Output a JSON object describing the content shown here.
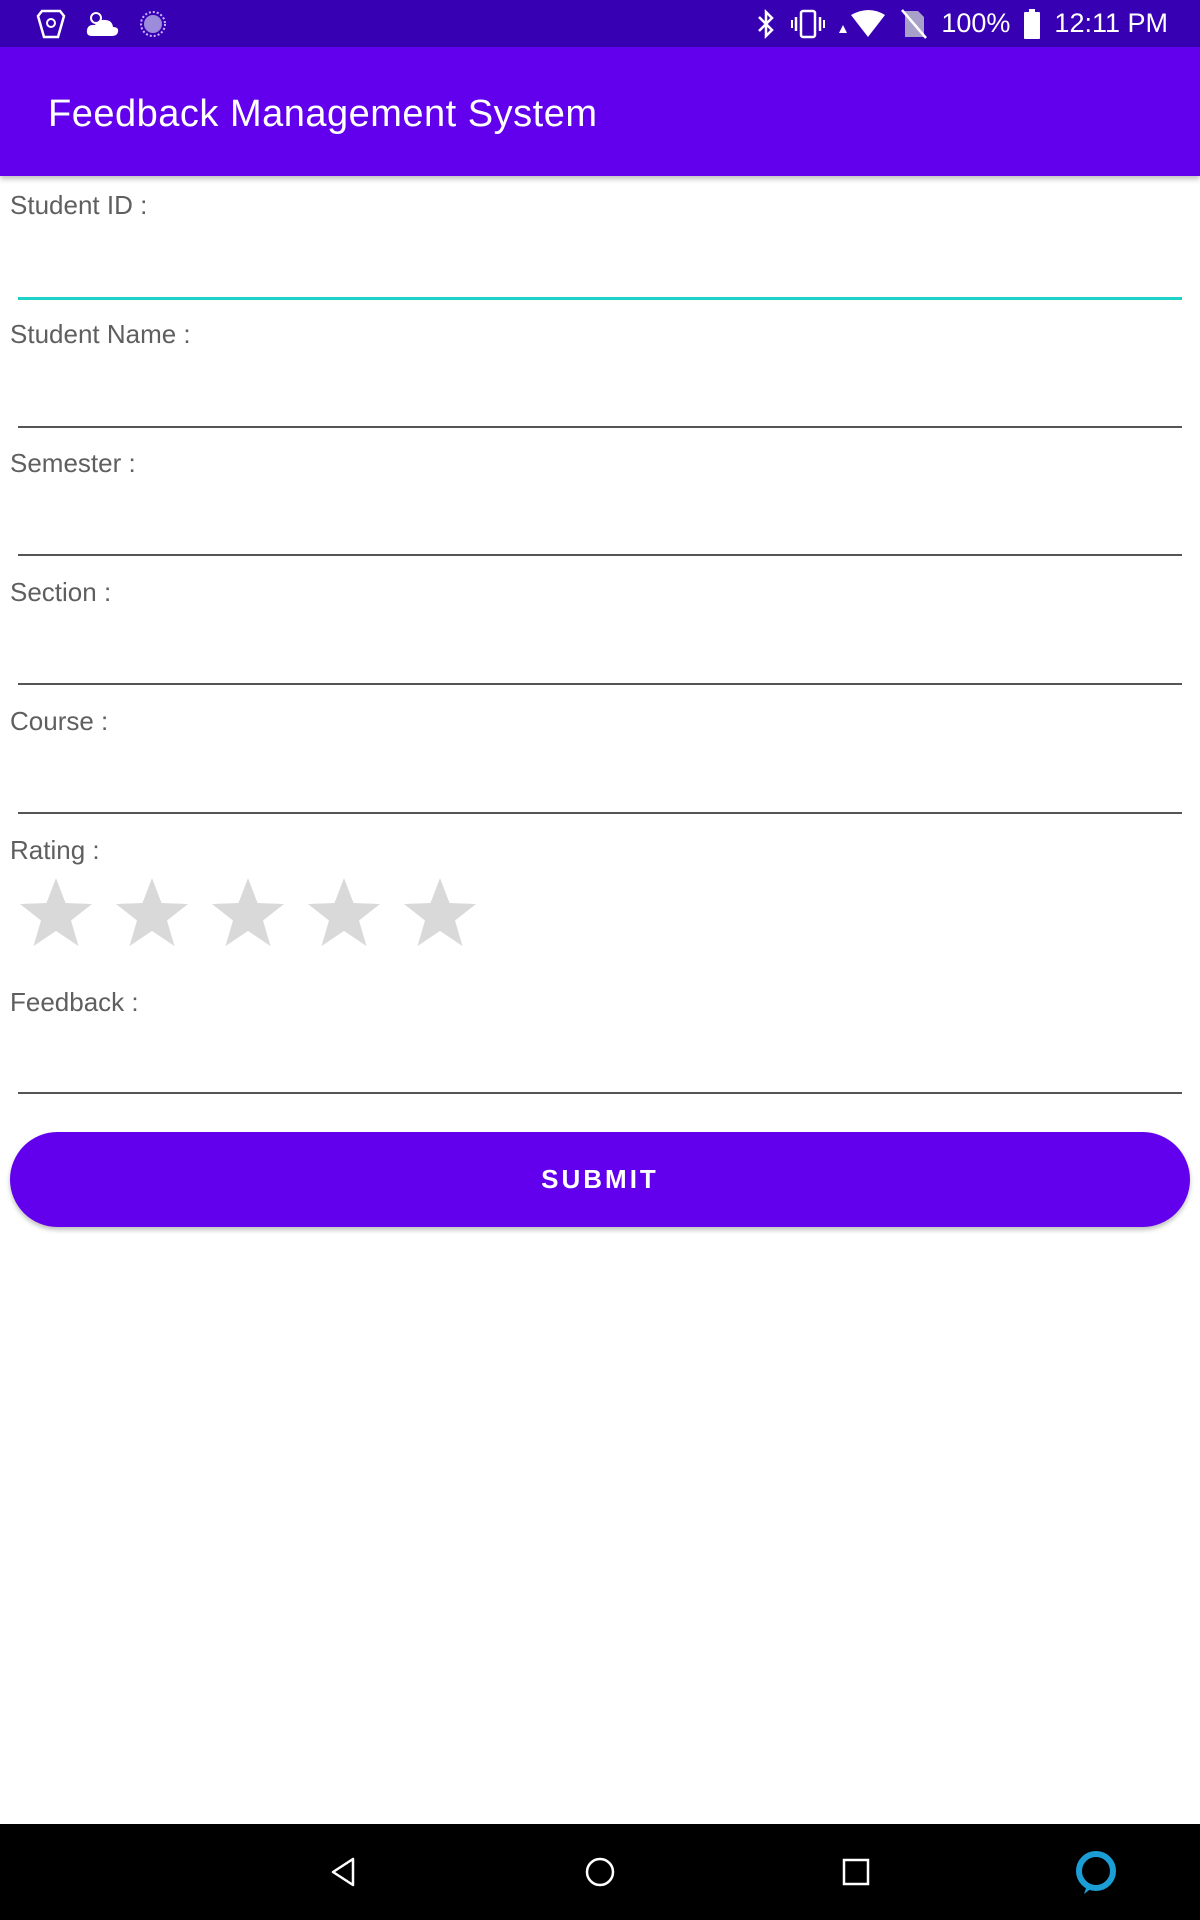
{
  "status_bar": {
    "battery": "100%",
    "time": "12:11 PM",
    "left_icons": [
      "shield-notification-icon",
      "weather-icon",
      "sync-icon"
    ],
    "right_icons": [
      "bluetooth-icon",
      "vibrate-icon",
      "wifi-icon",
      "no-sim-icon",
      "battery-icon"
    ]
  },
  "app_bar": {
    "title": "Feedback Management System"
  },
  "form": {
    "student_id_label": "Student ID :",
    "student_id_value": "",
    "student_name_label": "Student Name :",
    "student_name_value": "",
    "semester_label": "Semester :",
    "semester_value": "",
    "section_label": "Section :",
    "section_value": "",
    "course_label": "Course :",
    "course_value": "",
    "rating_label": "Rating :",
    "rating_value": 0,
    "rating_max": 5,
    "feedback_label": "Feedback :",
    "feedback_value": "",
    "submit_label": "SUBMIT"
  },
  "colors": {
    "status_bar": "#3700b3",
    "primary": "#6200ee",
    "focus_underline": "#1bd1c8",
    "star_empty": "#d9d9d9",
    "nav_bar": "#000000"
  },
  "nav_bar": {
    "buttons": [
      "back-icon",
      "home-icon",
      "recents-icon",
      "assistant-icon"
    ]
  }
}
